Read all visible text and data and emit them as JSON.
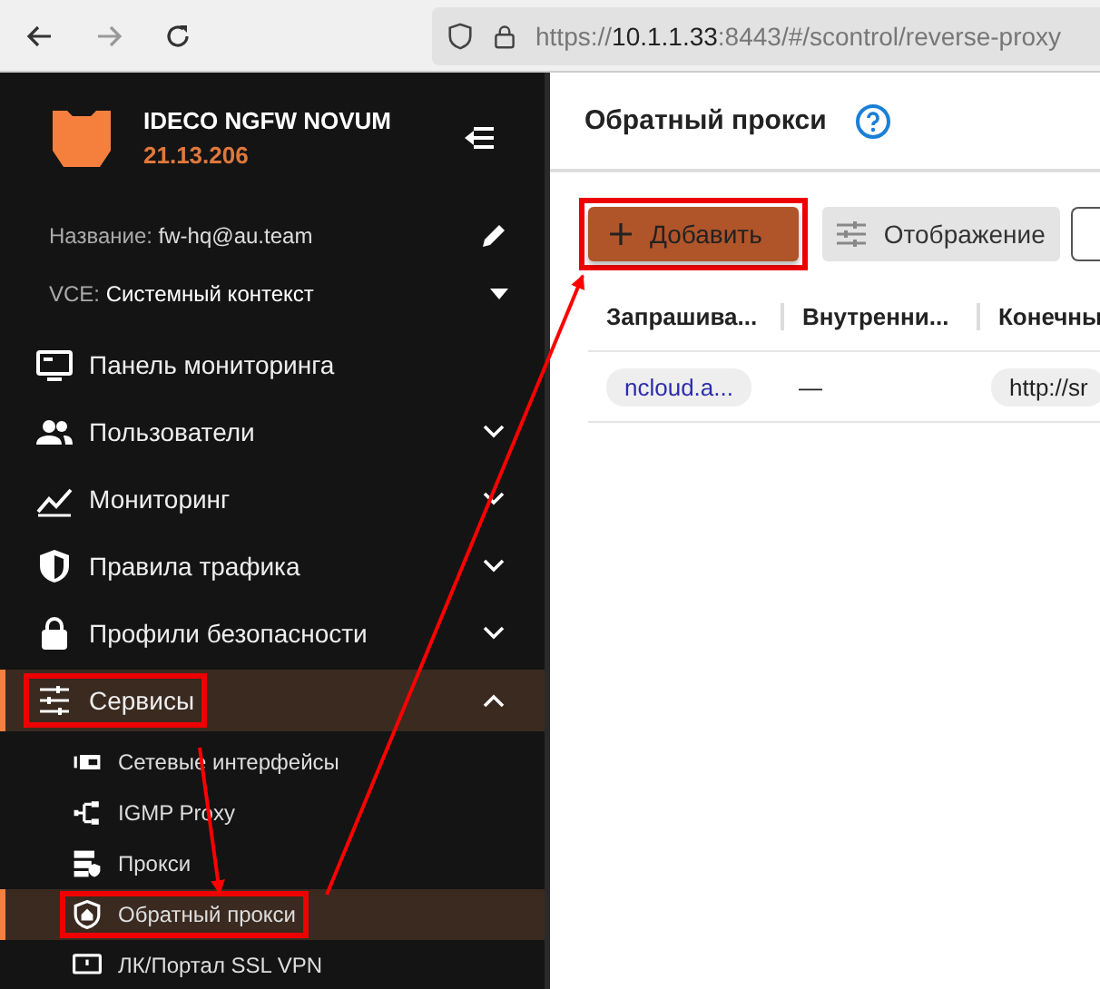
{
  "browser": {
    "url_scheme": "https://",
    "url_host": "10.1.1.33",
    "url_rest": ":8443/#/scontrol/reverse-proxy"
  },
  "sidebar": {
    "product": "IDECO NGFW NOVUM",
    "version": "21.13.206",
    "name_label": "Название:",
    "name_value": "fw-hq@au.team",
    "vce_label": "VCE:",
    "vce_value": "Системный контекст",
    "items": [
      {
        "label": "Панель мониторинга",
        "selected": false,
        "highlighted": false
      },
      {
        "label": "Пользователи",
        "expanded": false,
        "selected": false,
        "highlighted": false
      },
      {
        "label": "Мониторинг",
        "expanded": false,
        "selected": false,
        "highlighted": false
      },
      {
        "label": "Правила трафика",
        "expanded": false,
        "selected": false,
        "highlighted": false
      },
      {
        "label": "Профили безопасности",
        "expanded": false,
        "selected": false,
        "highlighted": false
      },
      {
        "label": "Сервисы",
        "expanded": true,
        "selected": true,
        "highlighted": true,
        "children": [
          {
            "label": "Сетевые интерфейсы",
            "selected": false,
            "highlighted": false
          },
          {
            "label": "IGMP Proxy",
            "selected": false,
            "highlighted": false
          },
          {
            "label": "Прокси",
            "selected": false,
            "highlighted": false
          },
          {
            "label": "Обратный прокси",
            "selected": true,
            "highlighted": true
          },
          {
            "label": "ЛК/Портал SSL VPN",
            "selected": false,
            "highlighted": false
          }
        ]
      }
    ]
  },
  "main": {
    "title": "Обратный прокси",
    "buttons": [
      {
        "label": "Добавить",
        "kind": "primary",
        "highlighted": true
      },
      {
        "label": "Отображение",
        "kind": "secondary",
        "highlighted": false
      }
    ],
    "table": {
      "columns": [
        "Запрашива...",
        "Внутренни...",
        "Конечны"
      ],
      "rows": [
        [
          "ncloud.a...",
          "—",
          "http://sr"
        ]
      ]
    }
  }
}
